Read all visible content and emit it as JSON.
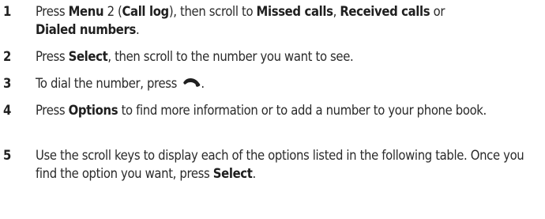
{
  "steps": [
    {
      "number": "1",
      "parts": {
        "t1": "Press ",
        "b1": "Menu",
        "t2": " 2 (",
        "b2": "Call log",
        "t3": "), then scroll to ",
        "b3": "Missed calls",
        "t4": ", ",
        "b4": "Received calls",
        "t5": " or ",
        "b5": "Dialed numbers",
        "t6": "."
      }
    },
    {
      "number": "2",
      "parts": {
        "t1": "Press ",
        "b1": "Select",
        "t2": ", then scroll to the number you want to see."
      }
    },
    {
      "number": "3",
      "parts": {
        "t1": "To dial the number, press ",
        "icon": "call-key-handset-icon",
        "t2": "."
      }
    },
    {
      "number": "4",
      "parts": {
        "t1": "Press ",
        "b1": "Options",
        "t2": " to find more information or to add a number to your phone book."
      }
    },
    {
      "number": "5",
      "parts": {
        "t1": "Use the scroll keys to display each of the options listed in the following table. Once you find the option you want, press ",
        "b1": "Select",
        "t2": "."
      }
    }
  ]
}
